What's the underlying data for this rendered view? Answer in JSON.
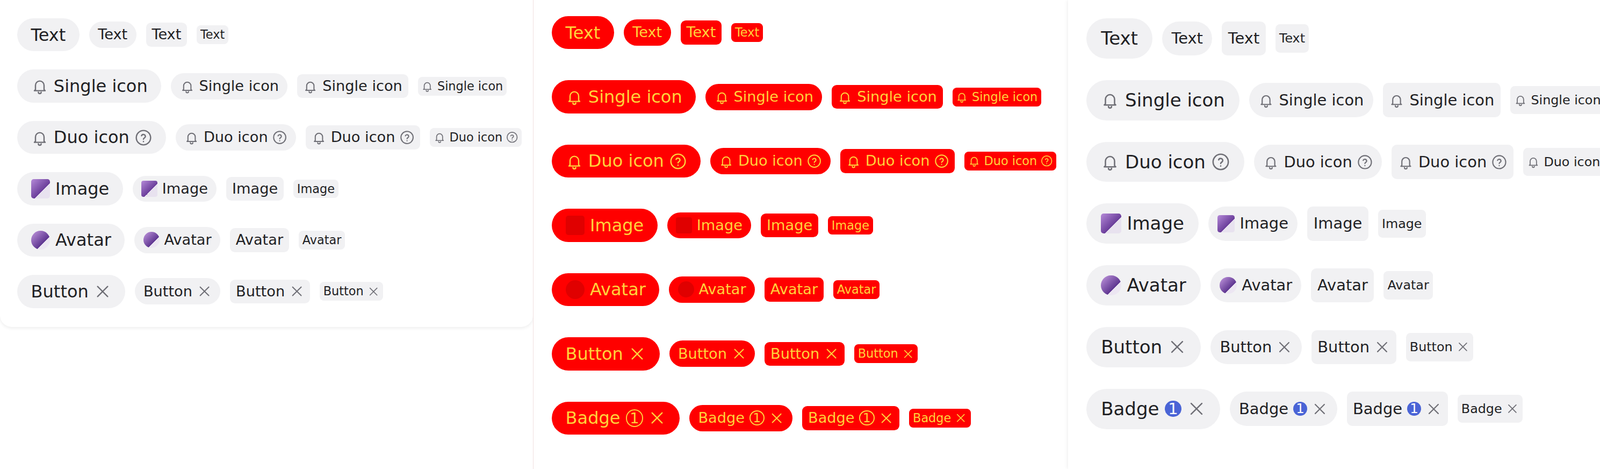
{
  "panels": [
    {
      "rows": [
        {
          "kind": "text",
          "chips": [
            {
              "label": "Text",
              "size": "xl"
            },
            {
              "label": "Text",
              "size": "lg"
            },
            {
              "label": "Text",
              "size": "md"
            },
            {
              "label": "Text",
              "size": "sm"
            }
          ]
        },
        {
          "kind": "single-icon",
          "chips": [
            {
              "label": "Single icon",
              "size": "xl"
            },
            {
              "label": "Single icon",
              "size": "lg"
            },
            {
              "label": "Single icon",
              "size": "md"
            },
            {
              "label": "Single icon",
              "size": "sm"
            }
          ]
        },
        {
          "kind": "duo-icon",
          "chips": [
            {
              "label": "Duo icon",
              "size": "xl"
            },
            {
              "label": "Duo icon",
              "size": "lg"
            },
            {
              "label": "Duo icon",
              "size": "md"
            },
            {
              "label": "Duo icon",
              "size": "sm"
            }
          ]
        },
        {
          "kind": "image",
          "chips": [
            {
              "label": "Image",
              "size": "xl",
              "image": true
            },
            {
              "label": "Image",
              "size": "lg",
              "image": true
            },
            {
              "label": "Image",
              "size": "md",
              "image": false
            },
            {
              "label": "Image",
              "size": "sm",
              "image": false
            }
          ]
        },
        {
          "kind": "avatar",
          "chips": [
            {
              "label": "Avatar",
              "size": "xl",
              "image": true
            },
            {
              "label": "Avatar",
              "size": "lg",
              "image": true
            },
            {
              "label": "Avatar",
              "size": "md",
              "image": false
            },
            {
              "label": "Avatar",
              "size": "sm",
              "image": false
            }
          ]
        },
        {
          "kind": "button",
          "chips": [
            {
              "label": "Button",
              "size": "xl"
            },
            {
              "label": "Button",
              "size": "lg"
            },
            {
              "label": "Button",
              "size": "md"
            },
            {
              "label": "Button",
              "size": "sm"
            }
          ]
        }
      ]
    },
    {
      "rows": [
        {
          "kind": "text",
          "chips": [
            {
              "label": "Text",
              "size": "xl"
            },
            {
              "label": "Text",
              "size": "lg"
            },
            {
              "label": "Text",
              "size": "md"
            },
            {
              "label": "Text",
              "size": "sm"
            }
          ]
        },
        {
          "kind": "single-icon",
          "chips": [
            {
              "label": "Single icon",
              "size": "xl"
            },
            {
              "label": "Single icon",
              "size": "lg"
            },
            {
              "label": "Single icon",
              "size": "md"
            },
            {
              "label": "Single icon",
              "size": "sm"
            }
          ]
        },
        {
          "kind": "duo-icon",
          "chips": [
            {
              "label": "Duo icon",
              "size": "xl"
            },
            {
              "label": "Duo icon",
              "size": "lg"
            },
            {
              "label": "Duo icon",
              "size": "md"
            },
            {
              "label": "Duo icon",
              "size": "sm"
            }
          ]
        },
        {
          "kind": "image",
          "chips": [
            {
              "label": "Image",
              "size": "xl",
              "image": true
            },
            {
              "label": "Image",
              "size": "lg",
              "image": true
            },
            {
              "label": "Image",
              "size": "md",
              "image": false
            },
            {
              "label": "Image",
              "size": "sm",
              "image": false
            }
          ]
        },
        {
          "kind": "avatar",
          "chips": [
            {
              "label": "Avatar",
              "size": "xl",
              "image": true
            },
            {
              "label": "Avatar",
              "size": "lg",
              "image": true
            },
            {
              "label": "Avatar",
              "size": "md",
              "image": false
            },
            {
              "label": "Avatar",
              "size": "sm",
              "image": false
            }
          ]
        },
        {
          "kind": "button",
          "chips": [
            {
              "label": "Button",
              "size": "xl"
            },
            {
              "label": "Button",
              "size": "lg"
            },
            {
              "label": "Button",
              "size": "md"
            },
            {
              "label": "Button",
              "size": "sm"
            }
          ]
        },
        {
          "kind": "badge",
          "chips": [
            {
              "label": "Badge",
              "size": "xl",
              "badge": "1"
            },
            {
              "label": "Badge",
              "size": "lg",
              "badge": "1"
            },
            {
              "label": "Badge",
              "size": "md",
              "badge": "1"
            },
            {
              "label": "Badge",
              "size": "sm"
            }
          ]
        }
      ]
    },
    {
      "rows": [
        {
          "kind": "text",
          "chips": [
            {
              "label": "Text",
              "size": "xl"
            },
            {
              "label": "Text",
              "size": "lg"
            },
            {
              "label": "Text",
              "size": "md"
            },
            {
              "label": "Text",
              "size": "sm"
            }
          ]
        },
        {
          "kind": "single-icon",
          "chips": [
            {
              "label": "Single icon",
              "size": "xl"
            },
            {
              "label": "Single icon",
              "size": "lg"
            },
            {
              "label": "Single icon",
              "size": "md"
            },
            {
              "label": "Single icon",
              "size": "sm"
            }
          ]
        },
        {
          "kind": "duo-icon",
          "chips": [
            {
              "label": "Duo icon",
              "size": "xl"
            },
            {
              "label": "Duo icon",
              "size": "lg"
            },
            {
              "label": "Duo icon",
              "size": "md"
            },
            {
              "label": "Duo icon",
              "size": "sm"
            }
          ]
        },
        {
          "kind": "image",
          "chips": [
            {
              "label": "Image",
              "size": "xl",
              "image": true
            },
            {
              "label": "Image",
              "size": "lg",
              "image": true
            },
            {
              "label": "Image",
              "size": "md",
              "image": false
            },
            {
              "label": "Image",
              "size": "sm",
              "image": false
            }
          ]
        },
        {
          "kind": "avatar",
          "chips": [
            {
              "label": "Avatar",
              "size": "xl",
              "image": true
            },
            {
              "label": "Avatar",
              "size": "lg",
              "image": true
            },
            {
              "label": "Avatar",
              "size": "md",
              "image": false
            },
            {
              "label": "Avatar",
              "size": "sm",
              "image": false
            }
          ]
        },
        {
          "kind": "button",
          "chips": [
            {
              "label": "Button",
              "size": "xl"
            },
            {
              "label": "Button",
              "size": "lg"
            },
            {
              "label": "Button",
              "size": "md"
            },
            {
              "label": "Button",
              "size": "sm"
            }
          ]
        },
        {
          "kind": "badge",
          "chips": [
            {
              "label": "Badge",
              "size": "xl",
              "badge": "1"
            },
            {
              "label": "Badge",
              "size": "lg",
              "badge": "1"
            },
            {
              "label": "Badge",
              "size": "md",
              "badge": "1"
            },
            {
              "label": "Badge",
              "size": "sm"
            }
          ]
        }
      ]
    }
  ]
}
